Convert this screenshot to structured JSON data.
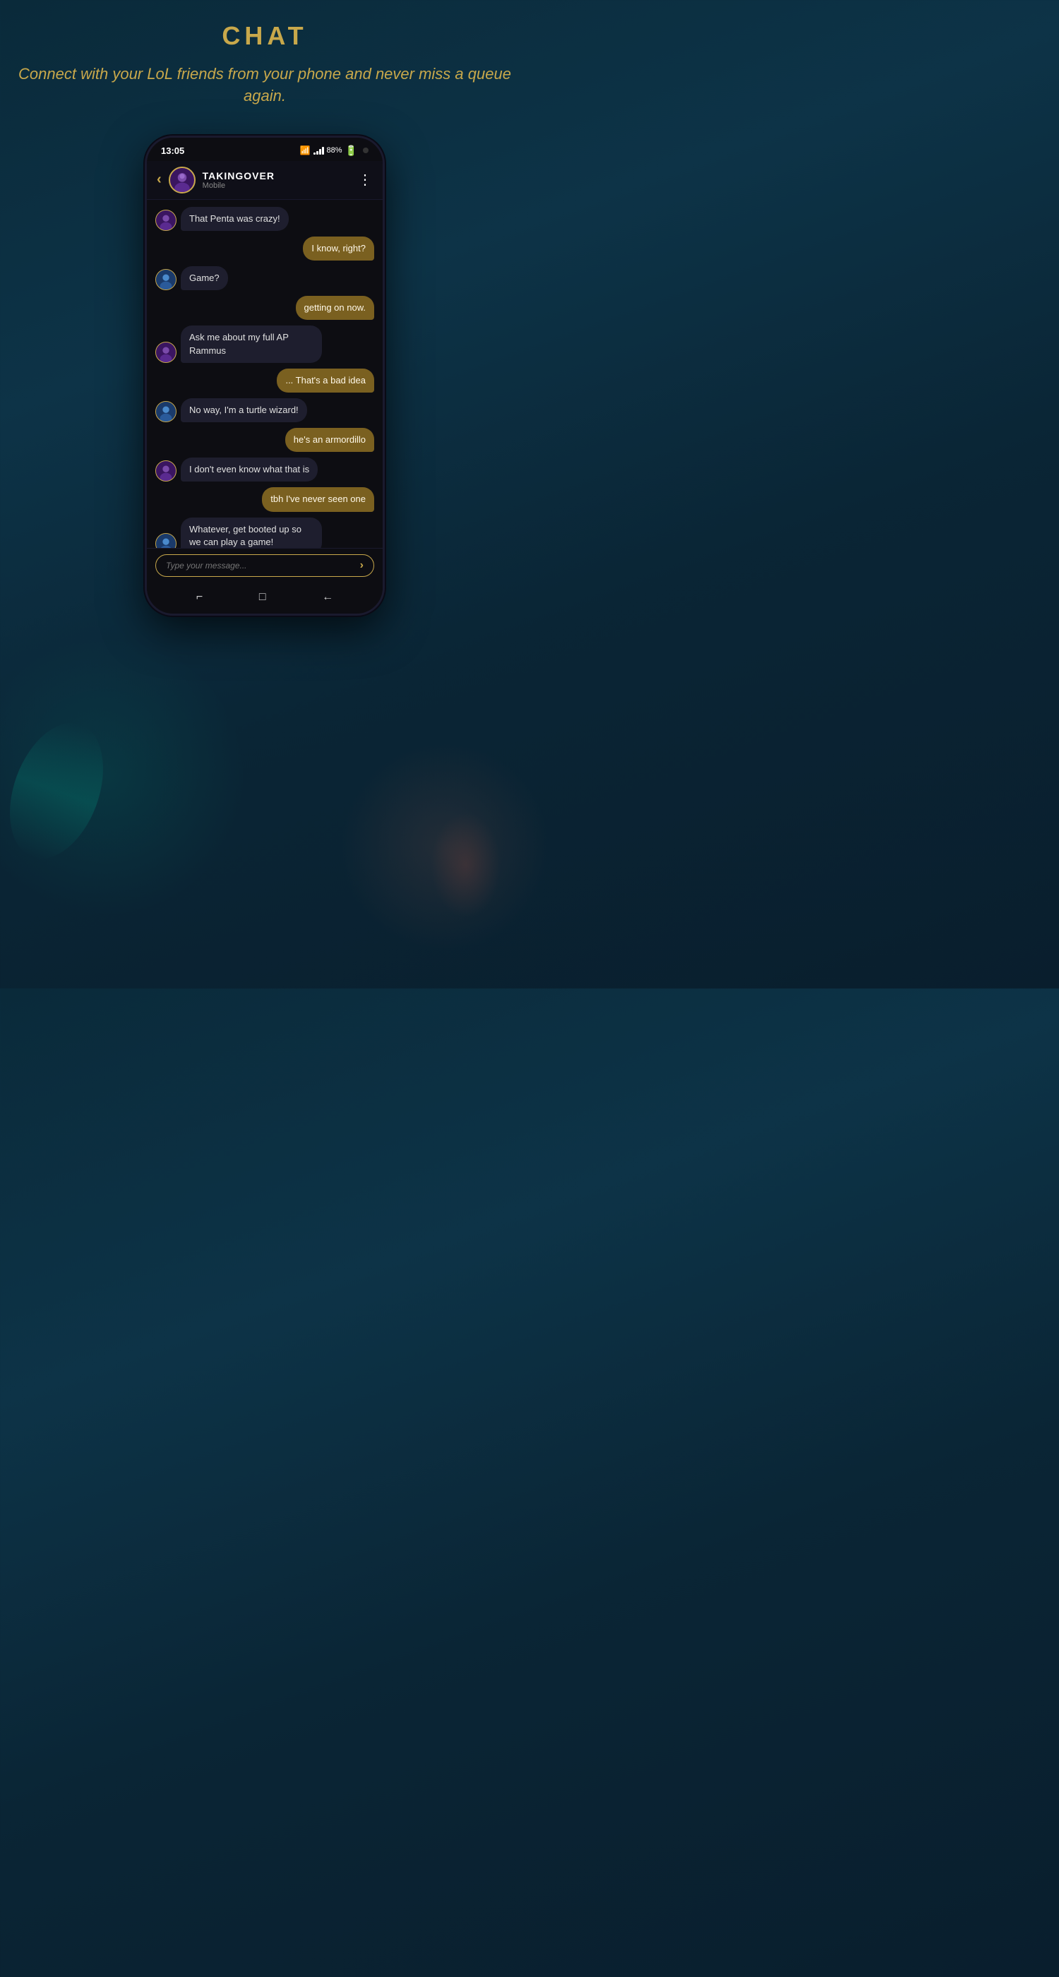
{
  "header": {
    "title": "CHAT",
    "subtitle": "Connect with your LoL friends from your phone and never miss a queue again."
  },
  "statusBar": {
    "time": "13:05",
    "battery": "88%",
    "signal": "wifi"
  },
  "chatHeader": {
    "name": "TAKINGOVER",
    "status": "Mobile",
    "backLabel": "‹",
    "moreLabel": "⋮"
  },
  "messages": [
    {
      "id": 1,
      "type": "received",
      "text": "That Penta was crazy!",
      "avatarType": "default"
    },
    {
      "id": 2,
      "type": "sent",
      "text": "I know, right?"
    },
    {
      "id": 3,
      "type": "received",
      "text": "Game?",
      "avatarType": "alt"
    },
    {
      "id": 4,
      "type": "sent",
      "text": "getting on now."
    },
    {
      "id": 5,
      "type": "received",
      "text": "Ask me about my full AP Rammus",
      "avatarType": "default"
    },
    {
      "id": 6,
      "type": "sent",
      "text": "... That's a bad idea"
    },
    {
      "id": 7,
      "type": "received",
      "text": "No way, I'm a turtle wizard!",
      "avatarType": "alt"
    },
    {
      "id": 8,
      "type": "sent",
      "text": "he's an armordillo"
    },
    {
      "id": 9,
      "type": "received",
      "text": "I don't even know what that is",
      "avatarType": "default"
    },
    {
      "id": 10,
      "type": "sent",
      "text": "tbh I've never seen one"
    },
    {
      "id": 11,
      "type": "received",
      "text": "Whatever, get booted up so we can play a game!",
      "avatarType": "alt"
    }
  ],
  "inputPlaceholder": "Type your message...",
  "sendIcon": "›",
  "navIcons": [
    "⌐",
    "□",
    "←"
  ]
}
